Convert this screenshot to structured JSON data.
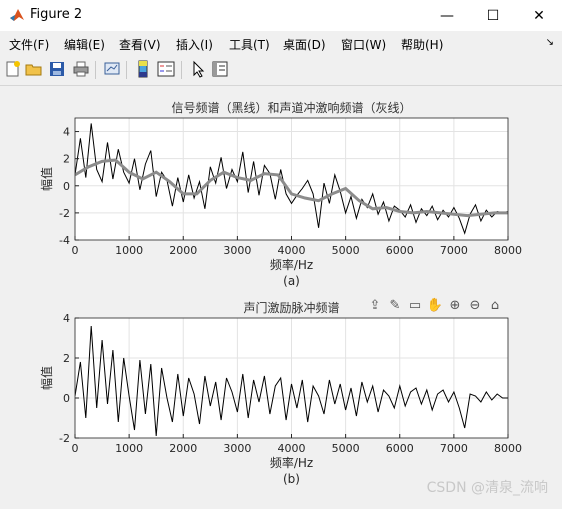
{
  "window": {
    "title": "Figure 2",
    "controls": {
      "minimize": "—",
      "maximize": "☐",
      "close": "✕"
    }
  },
  "menu": {
    "items": [
      "文件(F)",
      "编辑(E)",
      "查看(V)",
      "插入(I)",
      "工具(T)",
      "桌面(D)",
      "窗口(W)",
      "帮助(H)"
    ],
    "overflow": "↘"
  },
  "toolbar": {
    "icons": [
      "new-figure-icon",
      "open-file-icon",
      "save-icon",
      "print-icon",
      "link-plot-icon",
      "insert-colorbar-icon",
      "insert-legend-icon",
      "edit-plot-arrow-icon",
      "property-inspector-icon"
    ]
  },
  "axes_toolbar": {
    "icons": [
      "export-icon",
      "brush-icon",
      "data-tips-icon",
      "pan-icon",
      "zoom-in-icon",
      "zoom-out-icon",
      "home-icon"
    ]
  },
  "watermark": "CSDN @清泉_流响",
  "chart_data": [
    {
      "type": "line",
      "title": "信号频谱（黑线）和声道冲激响频谱（灰线）",
      "xlabel": "频率/Hz",
      "ylabel": "幅值",
      "caption": "(a)",
      "xlim": [
        0,
        8000
      ],
      "ylim": [
        -4,
        5
      ],
      "xticks": [
        0,
        1000,
        2000,
        3000,
        4000,
        5000,
        6000,
        7000,
        8000
      ],
      "yticks": [
        -4,
        -2,
        0,
        2,
        4
      ],
      "grid": true,
      "series": [
        {
          "color": "#000000",
          "x": [
            0,
            100,
            200,
            300,
            400,
            500,
            600,
            700,
            800,
            900,
            1000,
            1100,
            1200,
            1300,
            1400,
            1500,
            1600,
            1700,
            1800,
            1900,
            2000,
            2100,
            2200,
            2300,
            2400,
            2500,
            2600,
            2700,
            2800,
            2900,
            3000,
            3100,
            3200,
            3300,
            3400,
            3500,
            3600,
            3700,
            3800,
            3900,
            4000,
            4100,
            4200,
            4300,
            4400,
            4500,
            4600,
            4700,
            4800,
            4900,
            5000,
            5100,
            5200,
            5300,
            5400,
            5500,
            5600,
            5700,
            5800,
            5900,
            6000,
            6100,
            6200,
            6300,
            6400,
            6500,
            6600,
            6700,
            6800,
            6900,
            7000,
            7100,
            7200,
            7300,
            7400,
            7500,
            7600,
            7700,
            7800,
            7900,
            8000
          ],
          "y": [
            0.8,
            3.5,
            0.6,
            4.6,
            1.2,
            0.3,
            3.2,
            0.5,
            2.7,
            1.0,
            0.2,
            2.0,
            -0.3,
            1.6,
            2.6,
            -0.8,
            1.0,
            0.4,
            -1.5,
            0.6,
            -1.2,
            0.8,
            -0.9,
            0.3,
            -1.7,
            1.4,
            0.2,
            2.1,
            -0.2,
            1.2,
            0.3,
            2.5,
            -0.5,
            1.8,
            -0.7,
            1.5,
            0.9,
            -1.0,
            1.2,
            -0.6,
            -1.3,
            -0.7,
            -0.2,
            0.4,
            -0.6,
            -3.1,
            0.2,
            -1.3,
            0.8,
            -0.4,
            -2.0,
            -0.8,
            -2.4,
            -1.0,
            -1.6,
            -0.6,
            -2.1,
            -1.2,
            -2.6,
            -1.5,
            -1.8,
            -2.3,
            -1.4,
            -2.7,
            -1.7,
            -2.2,
            -1.5,
            -2.5,
            -1.8,
            -2.3,
            -1.6,
            -2.4,
            -3.5,
            -2.1,
            -1.4,
            -2.6,
            -1.8,
            -2.3,
            -1.9,
            -2.0,
            -1.9
          ]
        },
        {
          "color": "#8c8c8c",
          "x": [
            0,
            250,
            500,
            750,
            1000,
            1250,
            1500,
            1750,
            2000,
            2250,
            2500,
            2750,
            3000,
            3250,
            3500,
            3750,
            4000,
            4250,
            4500,
            4750,
            5000,
            5250,
            5500,
            5750,
            6000,
            6250,
            6500,
            6750,
            7000,
            7250,
            7500,
            7750,
            8000
          ],
          "y": [
            0.8,
            1.4,
            1.8,
            1.9,
            1.0,
            0.5,
            1.0,
            0.3,
            -0.6,
            -0.6,
            0.4,
            1.0,
            0.6,
            0.4,
            0.9,
            0.8,
            -0.6,
            -0.9,
            -1.1,
            -0.6,
            -0.2,
            -1.1,
            -1.7,
            -1.6,
            -1.9,
            -2.0,
            -1.9,
            -2.0,
            -2.1,
            -2.2,
            -2.1,
            -2.0,
            -2.0
          ]
        }
      ]
    },
    {
      "type": "line",
      "title": "声门激励脉冲频谱",
      "xlabel": "频率/Hz",
      "ylabel": "幅值",
      "caption": "(b)",
      "xlim": [
        0,
        8000
      ],
      "ylim": [
        -2,
        4
      ],
      "xticks": [
        0,
        1000,
        2000,
        3000,
        4000,
        5000,
        6000,
        7000,
        8000
      ],
      "yticks": [
        -2,
        0,
        2,
        4
      ],
      "grid": true,
      "series": [
        {
          "color": "#000000",
          "x": [
            0,
            100,
            200,
            300,
            400,
            500,
            600,
            700,
            800,
            900,
            1000,
            1100,
            1200,
            1300,
            1400,
            1500,
            1600,
            1700,
            1800,
            1900,
            2000,
            2100,
            2200,
            2300,
            2400,
            2500,
            2600,
            2700,
            2800,
            2900,
            3000,
            3100,
            3200,
            3300,
            3400,
            3500,
            3600,
            3700,
            3800,
            3900,
            4000,
            4100,
            4200,
            4300,
            4400,
            4500,
            4600,
            4700,
            4800,
            4900,
            5000,
            5100,
            5200,
            5300,
            5400,
            5500,
            5600,
            5700,
            5800,
            5900,
            6000,
            6100,
            6200,
            6300,
            6400,
            6500,
            6600,
            6700,
            6800,
            6900,
            7000,
            7100,
            7200,
            7300,
            7400,
            7500,
            7600,
            7700,
            7800,
            7900,
            8000
          ],
          "y": [
            0.1,
            1.8,
            -1.0,
            3.6,
            -0.5,
            2.9,
            -0.3,
            2.4,
            -1.2,
            2.0,
            0.1,
            -1.6,
            1.9,
            -0.8,
            1.7,
            -1.9,
            1.5,
            0.0,
            -1.2,
            1.2,
            -0.9,
            1.0,
            0.2,
            -1.3,
            1.1,
            -0.4,
            0.8,
            -1.1,
            1.0,
            0.3,
            -0.7,
            1.2,
            -1.0,
            0.9,
            -0.2,
            1.1,
            -0.8,
            0.6,
            1.0,
            -1.1,
            0.7,
            -0.5,
            0.9,
            -1.2,
            0.6,
            0.1,
            -0.8,
            0.9,
            -0.3,
            0.7,
            -0.6,
            0.5,
            -0.9,
            0.8,
            -0.2,
            0.6,
            -0.7,
            0.4,
            0.1,
            -0.5,
            0.6,
            -0.4,
            0.3,
            0.5,
            -0.3,
            0.4,
            -0.6,
            0.2,
            0.4,
            -0.2,
            0.3,
            -0.5,
            -1.5,
            0.2,
            0.1,
            -0.2,
            0.3,
            -0.1,
            0.2,
            0.0,
            0.0
          ]
        }
      ]
    }
  ]
}
